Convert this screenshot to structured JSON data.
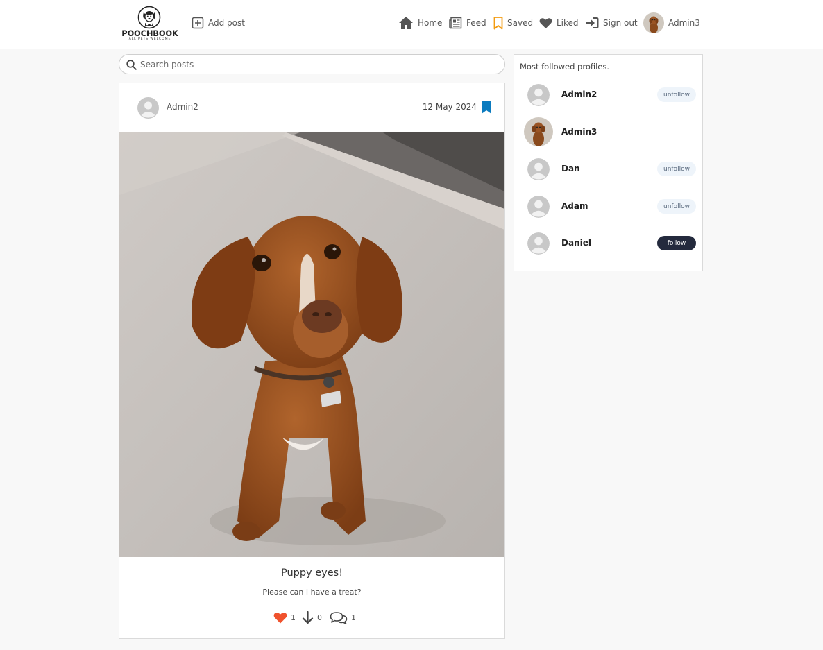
{
  "brand": {
    "name": "POOCHBOOK",
    "tagline": "ALL PETS WELCOME"
  },
  "nav": {
    "add_post": "Add post",
    "home": "Home",
    "feed": "Feed",
    "saved": "Saved",
    "liked": "Liked",
    "sign_out": "Sign out",
    "profile": "Admin3"
  },
  "search": {
    "placeholder": "Search posts",
    "value": ""
  },
  "post": {
    "owner": "Admin2",
    "date": "12 May 2024",
    "saved": true,
    "image_alt": "Brown dog sitting on carpet",
    "title": "Puppy eyes!",
    "content": "Please can I have a treat?",
    "likes_count": "1",
    "downloads_count": "0",
    "comments_count": "1"
  },
  "profiles_panel": {
    "title": "Most followed profiles.",
    "items": [
      {
        "name": "Admin2",
        "action": "unfollow"
      },
      {
        "name": "Admin3",
        "action": ""
      },
      {
        "name": "Dan",
        "action": "unfollow"
      },
      {
        "name": "Adam",
        "action": "unfollow"
      },
      {
        "name": "Daniel",
        "action": "follow"
      }
    ]
  },
  "colors": {
    "accent_orange": "#f39c12",
    "bookmark_blue": "#0b7bbf",
    "heart_red": "#f0522d",
    "follow_button": "#242a3d",
    "unfollow_button": "#eef4fa"
  },
  "icons": {
    "add_post": "plus-square-icon",
    "home": "house-icon",
    "feed": "newspaper-icon",
    "saved": "bookmark-icon",
    "liked": "heart-icon",
    "sign_out": "sign-in-arrow-icon",
    "search": "magnifier-icon",
    "download": "arrow-down-icon",
    "comments": "comments-icon"
  }
}
